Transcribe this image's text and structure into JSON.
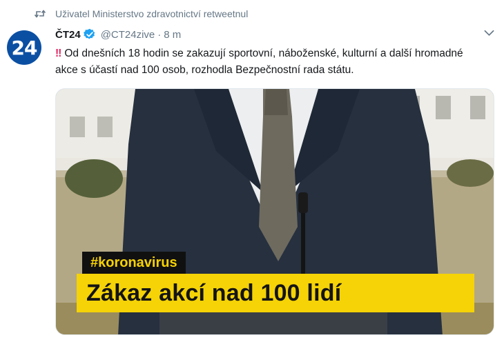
{
  "retweet": {
    "icon": "retweet-icon",
    "text": "Uživatel Ministerstvo zdravotnictví retweetnul"
  },
  "author": {
    "avatar_text": "24",
    "avatar_color": "#0b4fa3",
    "name": "ČT24",
    "verified_icon": "verified-badge-icon",
    "handle": "@CT24zive",
    "separator": "·",
    "time": "8 m"
  },
  "tweet": {
    "alert_icon": "‼",
    "text": "Od dnešních 18 hodin se zakazují sportovní, náboženské, kulturní a další hromadné akce s účastí nad 100 osob, rozhodla Bezpečnostní rada státu."
  },
  "media": {
    "tag": "#koronavirus",
    "headline": "Zákaz akcí nad 100 lidí",
    "tag_color": "#f7d200",
    "headline_bg": "#f5d306"
  },
  "colors": {
    "muted": "#657786",
    "text": "#14171a",
    "verified": "#1da1f2",
    "alert": "#e0245e"
  }
}
